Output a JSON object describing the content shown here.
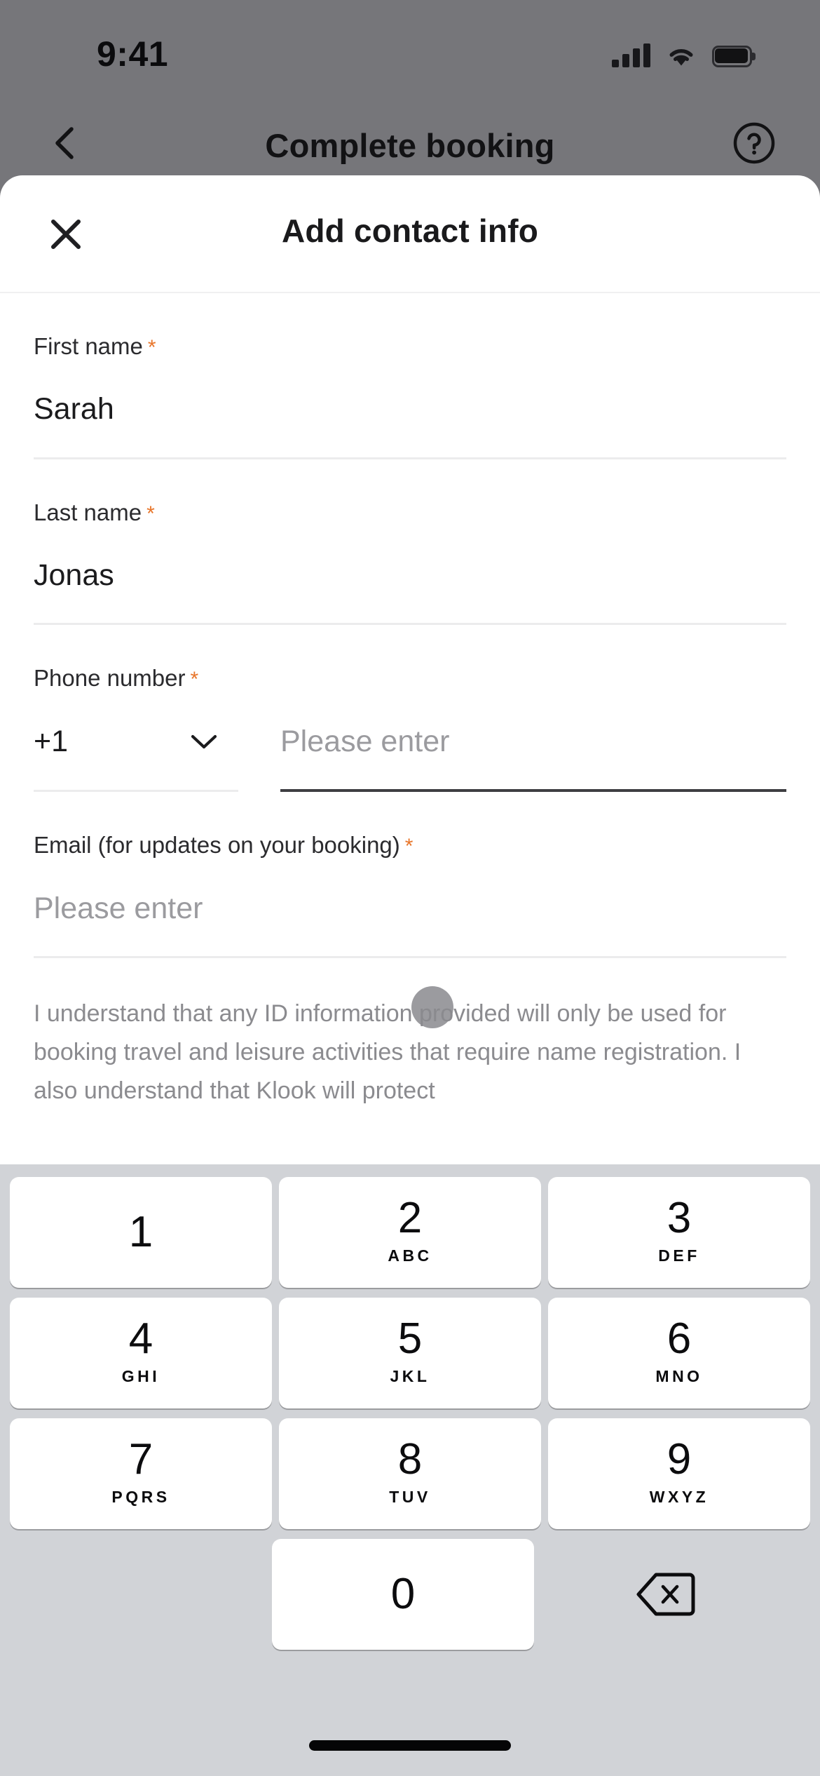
{
  "status_bar": {
    "time": "9:41",
    "signal_icon": "cellular-signal-icon",
    "wifi_icon": "wifi-icon",
    "battery_icon": "battery-icon"
  },
  "background_screen": {
    "nav": {
      "back_icon": "chevron-left-icon",
      "title": "Complete booking",
      "help_icon": "question-circle-icon"
    }
  },
  "modal": {
    "close_icon": "close-x-icon",
    "title": "Add contact info",
    "fields": [
      {
        "label": "First name",
        "required_marker": "*",
        "value": "Sarah",
        "is_placeholder": false,
        "focused": false
      },
      {
        "label": "Last name",
        "required_marker": "*",
        "value": "Jonas",
        "is_placeholder": false,
        "focused": false
      }
    ],
    "phone": {
      "label": "Phone number",
      "required_marker": "*",
      "country_code": "+1",
      "dropdown_icon": "chevron-down-icon",
      "placeholder": "Please enter",
      "value": "",
      "focused": true
    },
    "email": {
      "label": "Email (for updates on your booking)",
      "required_marker": "*",
      "placeholder": "Please enter",
      "value": "",
      "is_placeholder": true
    },
    "disclaimer": "I understand that any ID information provided will only be used for booking travel and leisure activities that require name registration. I also understand that Klook will protect"
  },
  "keypad": {
    "rows": [
      [
        {
          "num": "1",
          "letters": ""
        },
        {
          "num": "2",
          "letters": "ABC"
        },
        {
          "num": "3",
          "letters": "DEF"
        }
      ],
      [
        {
          "num": "4",
          "letters": "GHI"
        },
        {
          "num": "5",
          "letters": "JKL"
        },
        {
          "num": "6",
          "letters": "MNO"
        }
      ],
      [
        {
          "num": "7",
          "letters": "PQRS"
        },
        {
          "num": "8",
          "letters": "TUV"
        },
        {
          "num": "9",
          "letters": "WXYZ"
        }
      ]
    ],
    "zero_key": {
      "num": "0",
      "letters": ""
    },
    "backspace_icon": "backspace-delete-icon"
  },
  "colors": {
    "required_asterisk": "#e8762b",
    "keypad_background": "#d1d3d7",
    "active_underline": "#3e3e42",
    "inactive_underline": "#ececed",
    "dim_overlay": "#76767a",
    "placeholder_text": "#9b9b9f",
    "disclaimer_text": "#8b8b8f"
  },
  "tap_indicator": {
    "name": "touch-point-indicator"
  },
  "home_indicator": {
    "name": "home-indicator-bar"
  }
}
